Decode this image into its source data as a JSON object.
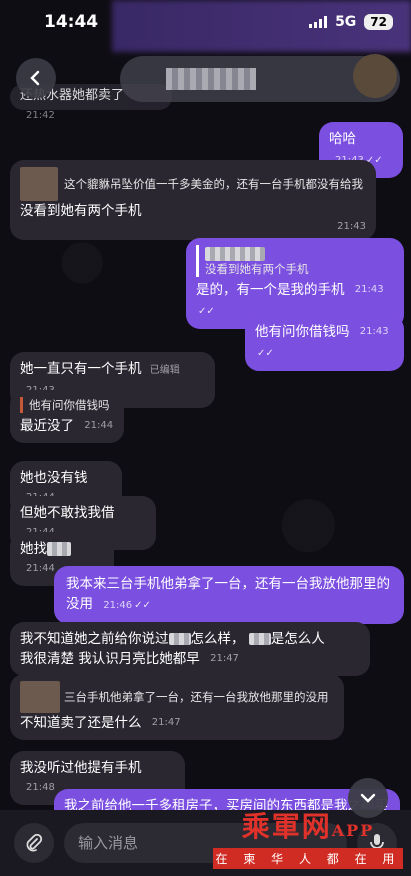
{
  "status_bar": {
    "time": "14:44",
    "network": "5G",
    "battery": "72"
  },
  "header": {
    "first_msg_partial": "还热水器她都卖了",
    "first_msg_time": "21:42"
  },
  "messages": [
    {
      "dir": "out",
      "text": "哈哈",
      "time": "21:43"
    },
    {
      "dir": "in",
      "quote": "这个貔貅吊坠价值一千多美金的，还有一台手机都没有给我",
      "text": "没看到她有两个手机",
      "time": "21:43"
    },
    {
      "dir": "out",
      "quote": "没看到她有两个手机",
      "text": "是的，有一个是我的手机",
      "time": "21:43"
    },
    {
      "dir": "out",
      "text": "他有问你借钱吗",
      "time": "21:43"
    },
    {
      "dir": "in",
      "text": "她一直只有一个手机",
      "edited": "已编辑",
      "time": "21:43"
    },
    {
      "dir": "in",
      "quote": "他有问你借钱吗",
      "text": "最近没了",
      "time": "21:44"
    },
    {
      "dir": "in",
      "text": "她也没有钱",
      "time": "21:44"
    },
    {
      "dir": "in",
      "text": "但她不敢找我借",
      "time": "21:44"
    },
    {
      "dir": "in",
      "text": "她找",
      "time": "21:44"
    },
    {
      "dir": "out",
      "text": "我本来三台手机他弟拿了一台，还有一台我放他那里的没用",
      "time": "21:46"
    },
    {
      "dir": "in",
      "text_a": "我不知道她之前给你说过",
      "text_b": "怎么样，",
      "text_c": "是怎么人",
      "text_d": "我很清楚 我认识月亮比她都早",
      "time": "21:47"
    },
    {
      "dir": "in",
      "quote": "三台手机他弟拿了一台，还有一台我放他那里的没用",
      "text": "不知道卖了还是什么",
      "time": "21:47"
    },
    {
      "dir": "in",
      "text": "我没听过他提有手机",
      "time": "21:48"
    },
    {
      "dir": "out",
      "text": "我之前给他一千多租房子，买房间的东西都是我之前买的"
    }
  ],
  "input": {
    "placeholder": "输入消息"
  },
  "watermark": {
    "title": "乘軍网",
    "app": "APP",
    "sub": "在 柬 华 人 都 在 用"
  },
  "colors": {
    "incoming": "#2a2731",
    "outgoing": "#7b4fe0",
    "background": "#0f0d14"
  }
}
